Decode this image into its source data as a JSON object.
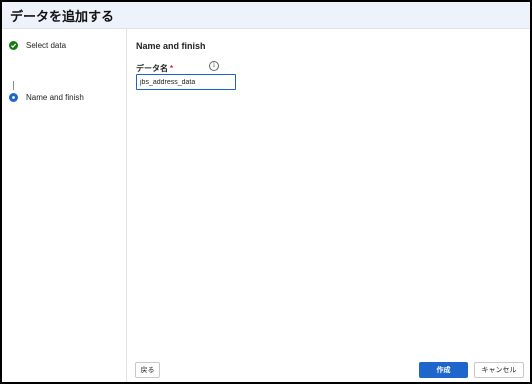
{
  "dialog": {
    "title": "データを追加する"
  },
  "steps": [
    {
      "label": "Select data",
      "status": "complete",
      "icon": "checkmark-icon",
      "color": "#107c10"
    },
    {
      "label": "Name and finish",
      "status": "current",
      "icon": "step-dot-icon",
      "color": "#1f66cc"
    }
  ],
  "main": {
    "section_title": "Name and finish",
    "field": {
      "label": "データ名",
      "required_mark": "*",
      "info_icon": "info-icon",
      "value": "jbs_address_data"
    }
  },
  "footer": {
    "back_label": "戻る",
    "create_label": "作成",
    "cancel_label": "キャンセル"
  },
  "colors": {
    "accent": "#1f66cc",
    "success": "#107c10",
    "titlebar": "#eef2fa"
  }
}
